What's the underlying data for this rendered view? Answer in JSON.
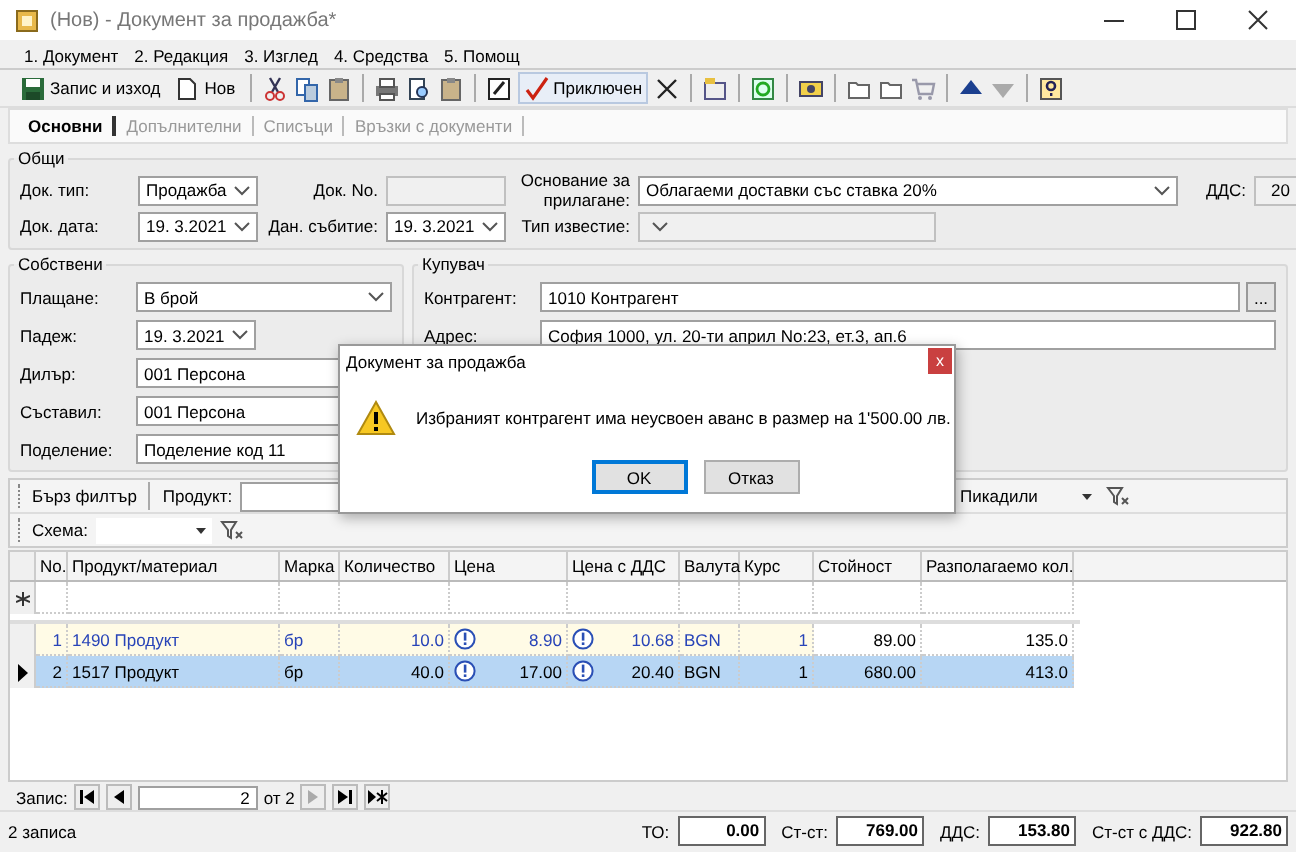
{
  "window": {
    "title": "(Нов) - Документ за продажба*"
  },
  "menu": [
    "1. Документ",
    "2. Редакция",
    "3. Изглед",
    "4. Средства",
    "5. Помощ"
  ],
  "toolbar": {
    "save": "Запис и изход",
    "new": "Нов",
    "finish": "Приключен"
  },
  "tabs": [
    {
      "label": "Основни",
      "selected": true
    },
    {
      "label": "Допълнителни",
      "selected": false
    },
    {
      "label": "Списъци",
      "selected": false
    },
    {
      "label": "Връзки с документи",
      "selected": false
    }
  ],
  "general": {
    "title": "Общи",
    "doc_type": {
      "label": "Док. тип:",
      "value": "Продажба",
      "kind": "combo"
    },
    "doc_no": {
      "label": "Док. No.",
      "kind": "text",
      "disabled": true
    },
    "basis": {
      "label": "Основание за прилагане:",
      "value": "Облагаеми доставки със ставка 20%",
      "kind": "combo"
    },
    "vat": {
      "label": "ДДС:",
      "value": "20",
      "kind": "text",
      "disabled": true
    },
    "doc_date": {
      "label": "Док. дата:",
      "value": "19. 3.2021",
      "kind": "combo"
    },
    "event_date": {
      "label": "Дан. събитие:",
      "value": "19. 3.2021",
      "kind": "combo"
    },
    "notice_type": {
      "label": "Тип известие:",
      "kind": "combo",
      "disabled": true
    }
  },
  "own": {
    "title": "Собствени",
    "fields": [
      {
        "label": "Плащане:",
        "value": "В брой",
        "kind": "combo"
      },
      {
        "label": "Падеж:",
        "value": "19. 3.2021",
        "kind": "combo"
      },
      {
        "label": "Дилър:",
        "value": "001 Персона",
        "kind": "text"
      },
      {
        "label": "Съставил:",
        "value": "001 Персона",
        "kind": "text"
      },
      {
        "label": "Поделение:",
        "value": "Поделение код 11",
        "kind": "text"
      }
    ]
  },
  "buyer": {
    "title": "Купувач",
    "counterparty": {
      "label": "Контрагент:",
      "value": "1010 Контрагент",
      "button": "..."
    },
    "address": {
      "label": "Адрес:",
      "value": "София 1000, ул. 20-ти април No:23, ет.3, ап.6"
    }
  },
  "filter": {
    "quick": "Бърз филтър",
    "product_label": "Продукт:",
    "brand": "Пикадили",
    "scheme_label": "Схема:"
  },
  "grid": {
    "columns": [
      "No.",
      "Продукт/материал",
      "Марка",
      "Количество",
      "Цена",
      "Цена с ДДС",
      "Валута",
      "Курс",
      "Стойност",
      "Разполагаемо кол."
    ],
    "rows": [
      {
        "selected": false,
        "highlighted": true,
        "cells": [
          "1",
          "1490 Продукт",
          "бр",
          "10.0",
          "8.90",
          "10.68",
          "BGN",
          "1",
          "89.00",
          "135.0"
        ]
      },
      {
        "selected": true,
        "highlighted": false,
        "cells": [
          "2",
          "1517 Продукт",
          "бр",
          "40.0",
          "17.00",
          "20.40",
          "BGN",
          "1",
          "680.00",
          "413.0"
        ]
      }
    ]
  },
  "navigator": {
    "label": "Запис:",
    "current": "2",
    "total": "от 2"
  },
  "status": {
    "records": "2 записа",
    "totals": [
      {
        "label": "ТО:",
        "value": "0.00"
      },
      {
        "label": "Ст-ст:",
        "value": "769.00"
      },
      {
        "label": "ДДС:",
        "value": "153.80"
      },
      {
        "label": "Ст-ст с ДДС:",
        "value": "922.80"
      }
    ]
  },
  "dialog": {
    "title": "Документ за продажба",
    "close": "x",
    "message": "Избраният контрагент има неусвоен аванс в размер на 1'500.00 лв.",
    "buttons": [
      {
        "label": "OK",
        "selected": true
      },
      {
        "label": "Отказ",
        "selected": false
      }
    ]
  }
}
